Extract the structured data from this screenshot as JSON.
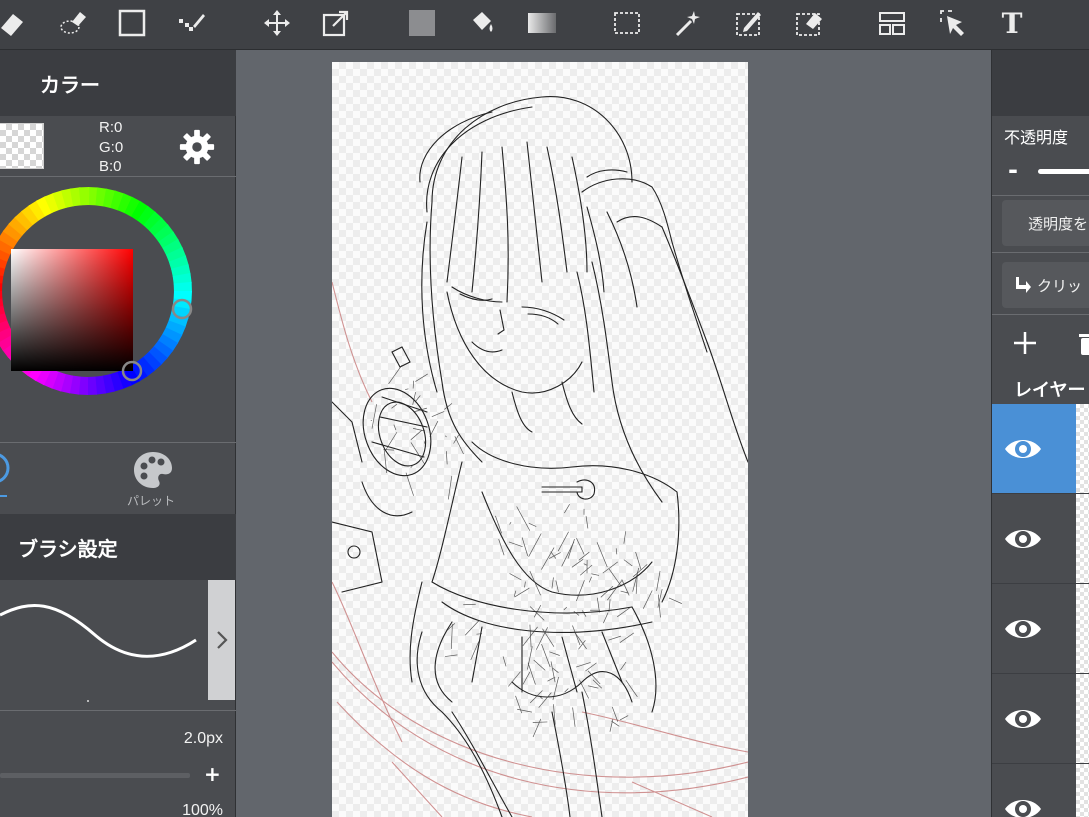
{
  "colors": {
    "toolbar_bg": "#3f4145",
    "panel_bg": "#4a4c50",
    "panel_header_bg": "#3b3d41",
    "workspace_bg": "#62666c",
    "accent_blue": "#4a90d6",
    "sketch_black": "#1e1e1e",
    "sketch_red": "#c97a7a"
  },
  "toolbar": {
    "tools": [
      {
        "name": "eraser-icon"
      },
      {
        "name": "lasso-eraser-icon"
      },
      {
        "name": "rectangle-icon"
      },
      {
        "name": "dot-pen-icon"
      },
      {
        "name": "move-icon"
      },
      {
        "name": "transform-icon"
      },
      {
        "name": "fill-color-icon"
      },
      {
        "name": "bucket-icon"
      },
      {
        "name": "gradient-icon"
      },
      {
        "name": "select-rect-icon"
      },
      {
        "name": "magic-wand-icon"
      },
      {
        "name": "select-pen-icon"
      },
      {
        "name": "select-eraser-icon"
      },
      {
        "name": "layout-icon"
      },
      {
        "name": "operation-icon"
      },
      {
        "name": "text-icon"
      }
    ],
    "text_tool_label": "T"
  },
  "color_panel": {
    "title": "カラー",
    "r": "R:0",
    "g": "G:0",
    "b": "B:0",
    "current_color": "#000000",
    "tabs": {
      "palette_label": "パレット"
    }
  },
  "brush_panel": {
    "title": "ブラシ設定",
    "size": "2.0px",
    "opacity": "100%"
  },
  "layer_panel": {
    "opacity_label": "不透明度",
    "opacity_minus": "-",
    "protect_alpha_label": "透明度を",
    "clipping_label": "クリッ",
    "heading": "レイヤー",
    "layers": [
      {
        "visible": true,
        "selected": true
      },
      {
        "visible": true,
        "selected": false
      },
      {
        "visible": true,
        "selected": false
      },
      {
        "visible": true,
        "selected": false
      },
      {
        "visible": true,
        "selected": false
      }
    ]
  }
}
